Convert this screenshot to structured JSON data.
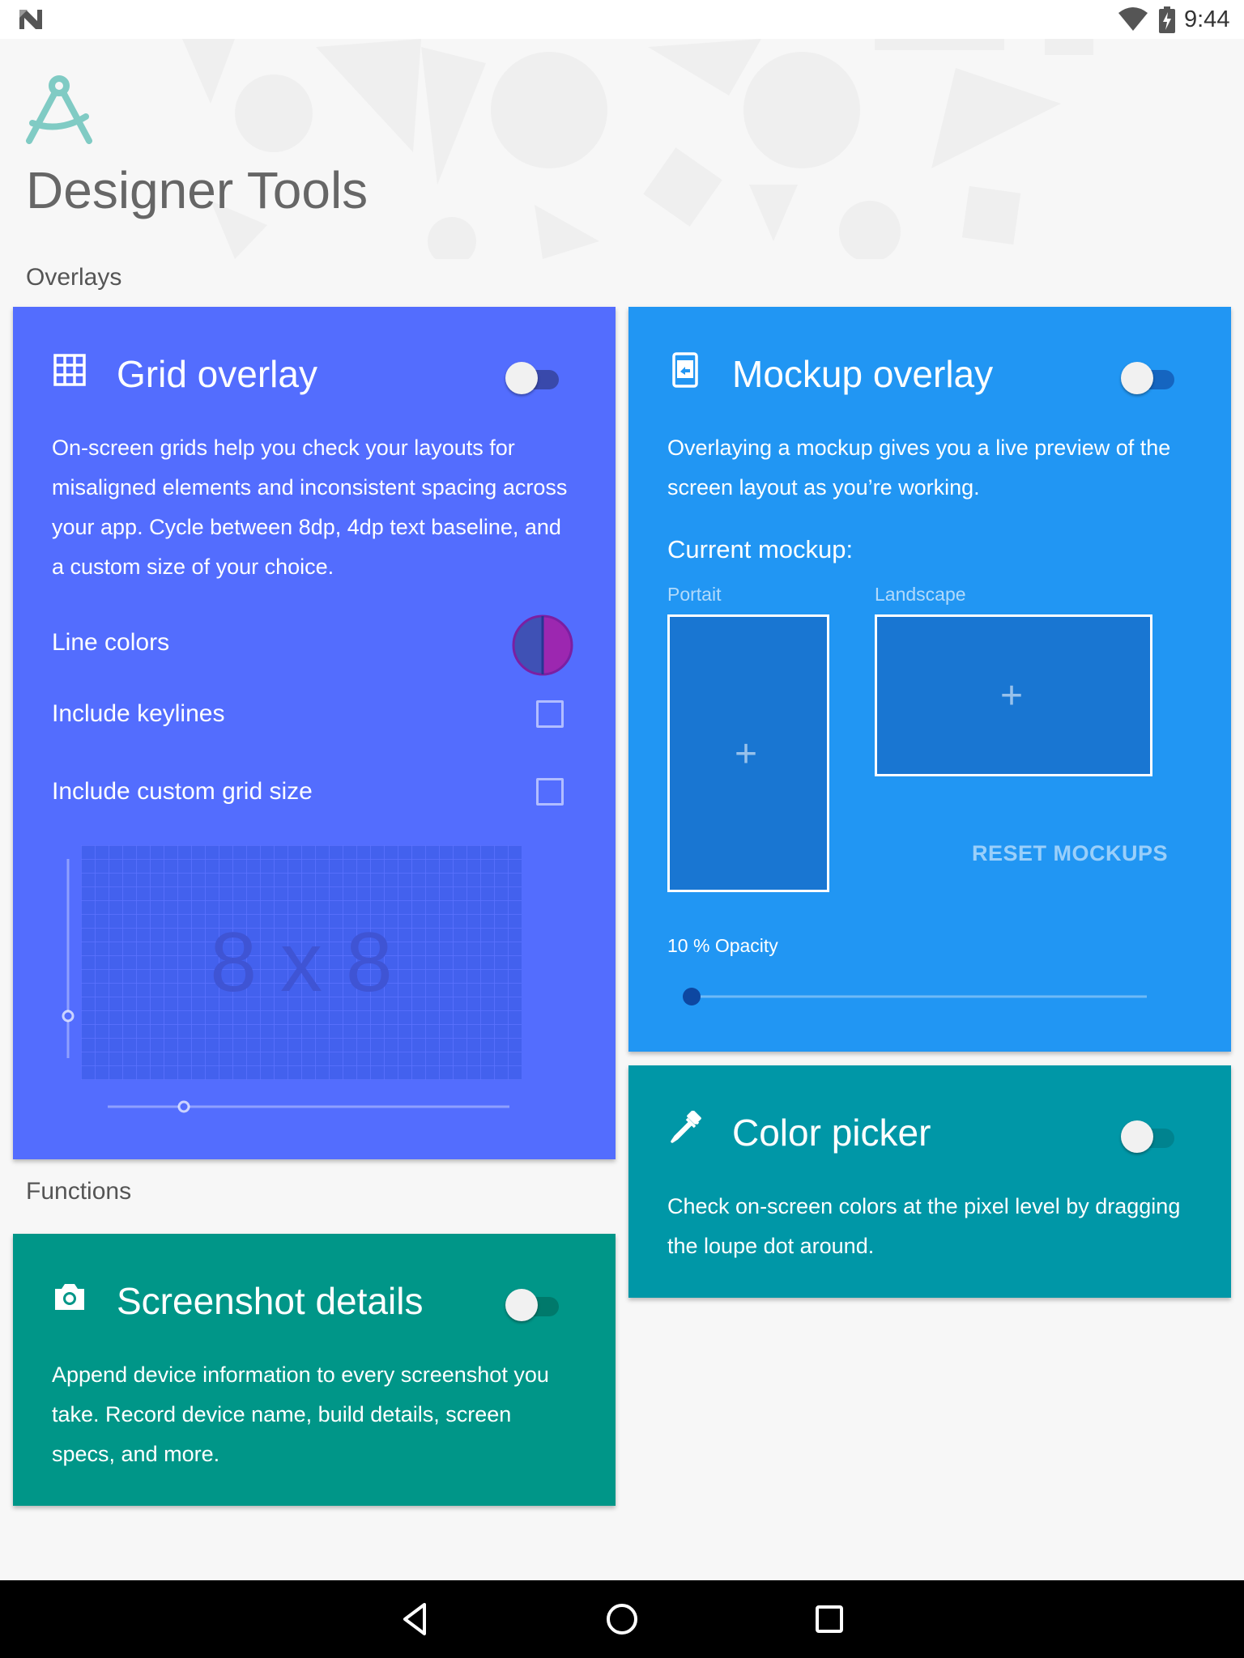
{
  "status_bar": {
    "time": "9:44",
    "icons": [
      "notification-n-icon",
      "wifi-icon",
      "battery-charging-icon"
    ]
  },
  "app": {
    "title": "Designer Tools",
    "logo_icon": "compass-icon"
  },
  "sections": {
    "overlays": "Overlays",
    "functions": "Functions"
  },
  "grid_overlay": {
    "title": "Grid overlay",
    "icon": "grid-icon",
    "enabled": false,
    "description": "On-screen grids help you check your layouts for misaligned elements and inconsistent spacing across your app. Cycle between 8dp, 4dp text baseline, and a custom size of your choice.",
    "line_colors_label": "Line colors",
    "line_colors": [
      "#3f51b5",
      "#9c27b0"
    ],
    "include_keylines_label": "Include keylines",
    "include_keylines_checked": false,
    "include_custom_grid_label": "Include custom grid size",
    "include_custom_grid_checked": false,
    "grid_size_label": "8 x 8"
  },
  "mockup_overlay": {
    "title": "Mockup overlay",
    "icon": "phone-mockup-icon",
    "enabled": false,
    "description": "Overlaying a mockup gives you a live preview of the screen layout as you’re working.",
    "current_mockup_label": "Current mockup:",
    "portrait_label": "Portait",
    "landscape_label": "Landscape",
    "add_symbol": "+",
    "reset_label": "RESET MOCKUPS",
    "opacity_label": "10 % Opacity",
    "opacity_percent": 10
  },
  "color_picker": {
    "title": "Color picker",
    "icon": "eyedropper-icon",
    "enabled": false,
    "description": "Check on-screen colors at the pixel level by dragging the loupe dot around."
  },
  "screenshot_details": {
    "title": "Screenshot details",
    "icon": "camera-icon",
    "enabled": false,
    "description": "Append device information to every screenshot you take. Record device name, build details, screen specs, and more."
  },
  "nav_bar": {
    "buttons": [
      "back-icon",
      "home-icon",
      "recents-icon"
    ]
  },
  "colors": {
    "grid_card": "#536dfe",
    "mockup_card": "#2196f3",
    "color_picker_card": "#0097a7",
    "screenshot_card": "#009688",
    "logo": "#80cbc4"
  }
}
